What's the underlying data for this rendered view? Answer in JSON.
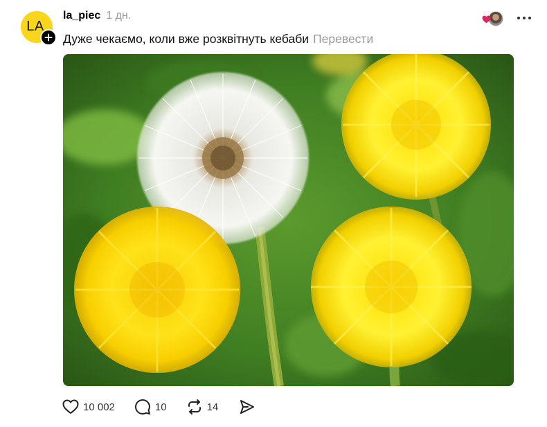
{
  "author": {
    "avatar_initials": "LA",
    "avatar_color": "#f9d51c",
    "username": "la_piec",
    "time": "1 дн."
  },
  "post": {
    "caption": "Дуже чекаємо, коли вже розквітнуть кебаби",
    "translate_label": "Перевести",
    "image_subject": "dandelions"
  },
  "icons": {
    "follow": "plus-icon",
    "likers": "heart-icon",
    "more": "ellipsis-icon",
    "like": "heart-icon",
    "comment": "comment-icon",
    "repost": "repost-icon",
    "share": "send-icon"
  },
  "actions": {
    "likes": "10 002",
    "comments": "10",
    "reposts": "14"
  },
  "colors": {
    "text_secondary": "#999999",
    "like_heart": "#e0245e"
  }
}
